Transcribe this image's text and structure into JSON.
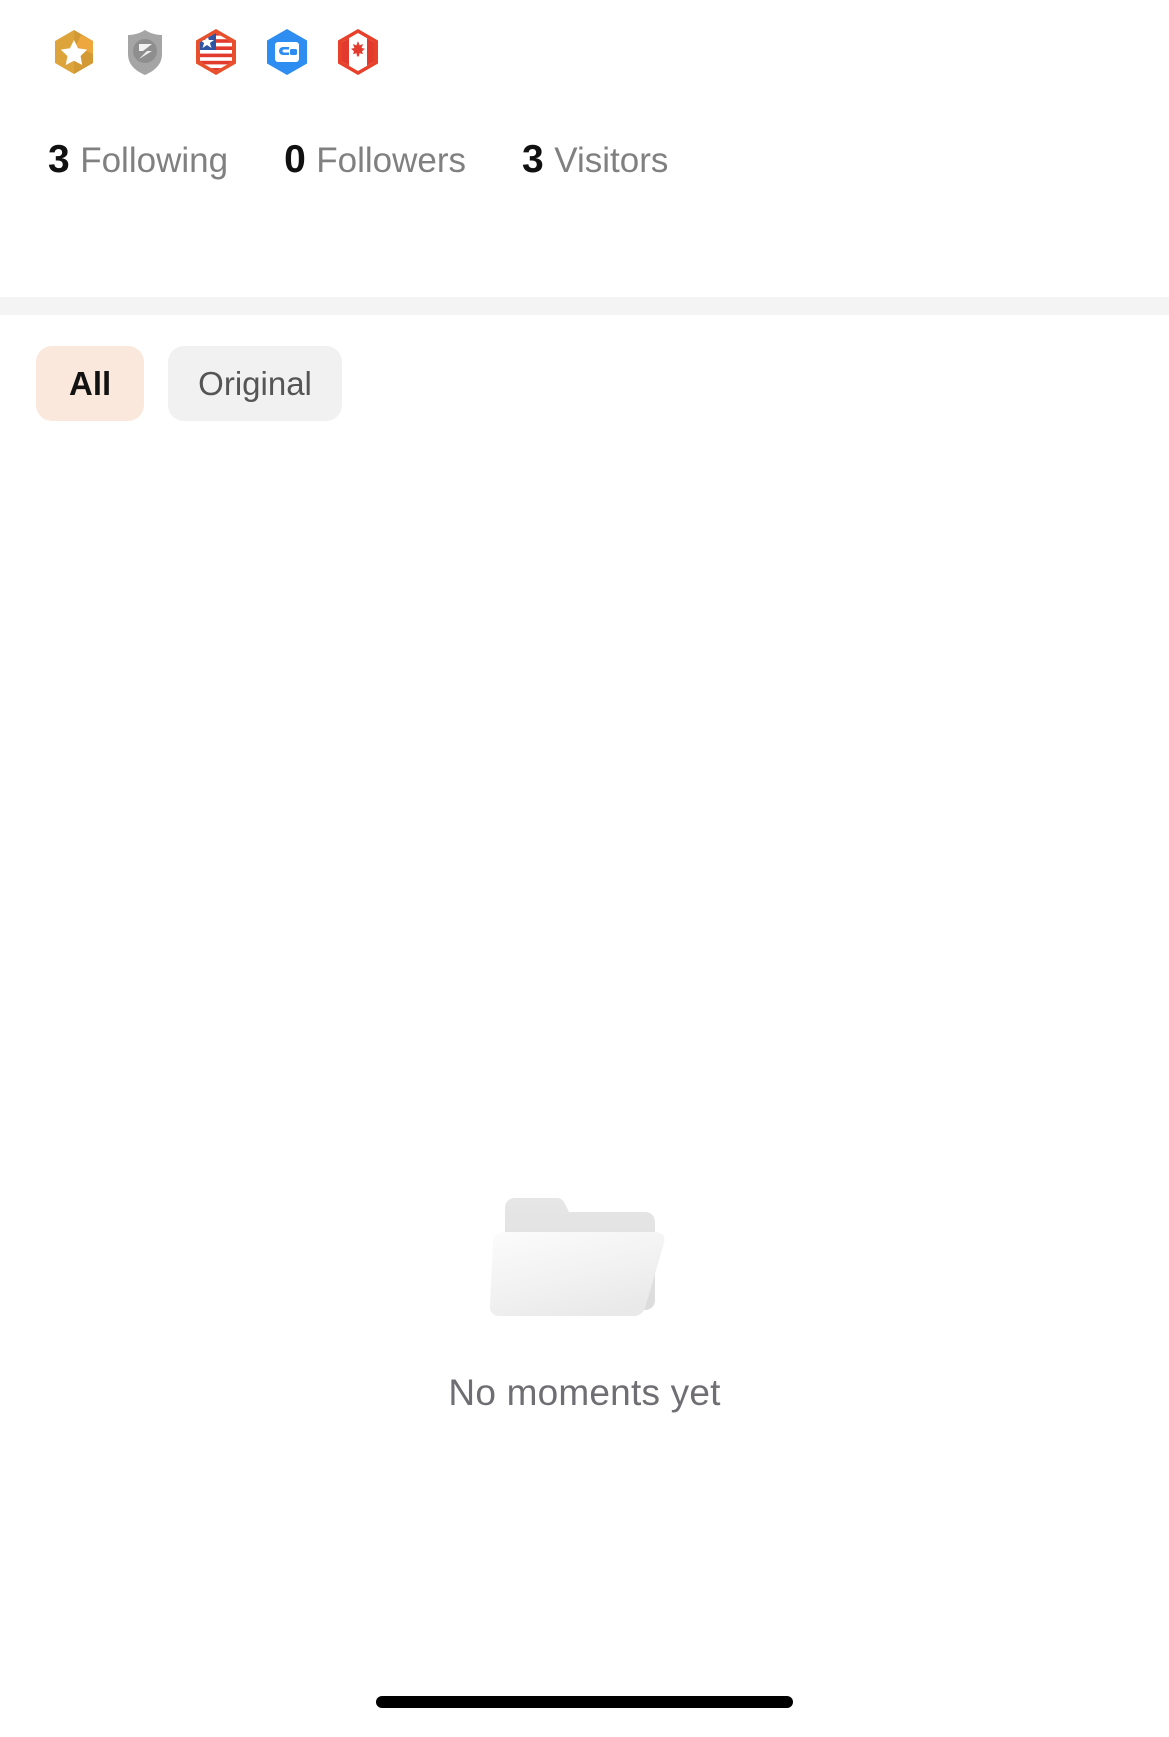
{
  "badges": [
    {
      "name": "badge-star-gold",
      "label": "Gold star badge",
      "color": "#d9a13b"
    },
    {
      "name": "badge-shield-grey",
      "label": "Grey shield badge",
      "color": "#9e9e9e"
    },
    {
      "name": "badge-flag-usa",
      "label": "US flag badge",
      "color": "#e8502b"
    },
    {
      "name": "badge-wallet-blue",
      "label": "Blue wallet badge",
      "color": "#2d8df0"
    },
    {
      "name": "badge-flag-canada",
      "label": "Canada flag badge",
      "color": "#e8402b"
    }
  ],
  "stats": [
    {
      "count": "3",
      "label": "Following"
    },
    {
      "count": "0",
      "label": "Followers"
    },
    {
      "count": "3",
      "label": "Visitors"
    }
  ],
  "filters": {
    "tabs": [
      {
        "label": "All",
        "selected": true
      },
      {
        "label": "Original",
        "selected": false
      }
    ],
    "selected_bg": "#fbe8dc",
    "unselected_bg": "#f1f1f1"
  },
  "empty_state": {
    "icon": "empty-folder-icon",
    "message": "No moments yet"
  },
  "system": {
    "home_indicator": "home-indicator"
  }
}
